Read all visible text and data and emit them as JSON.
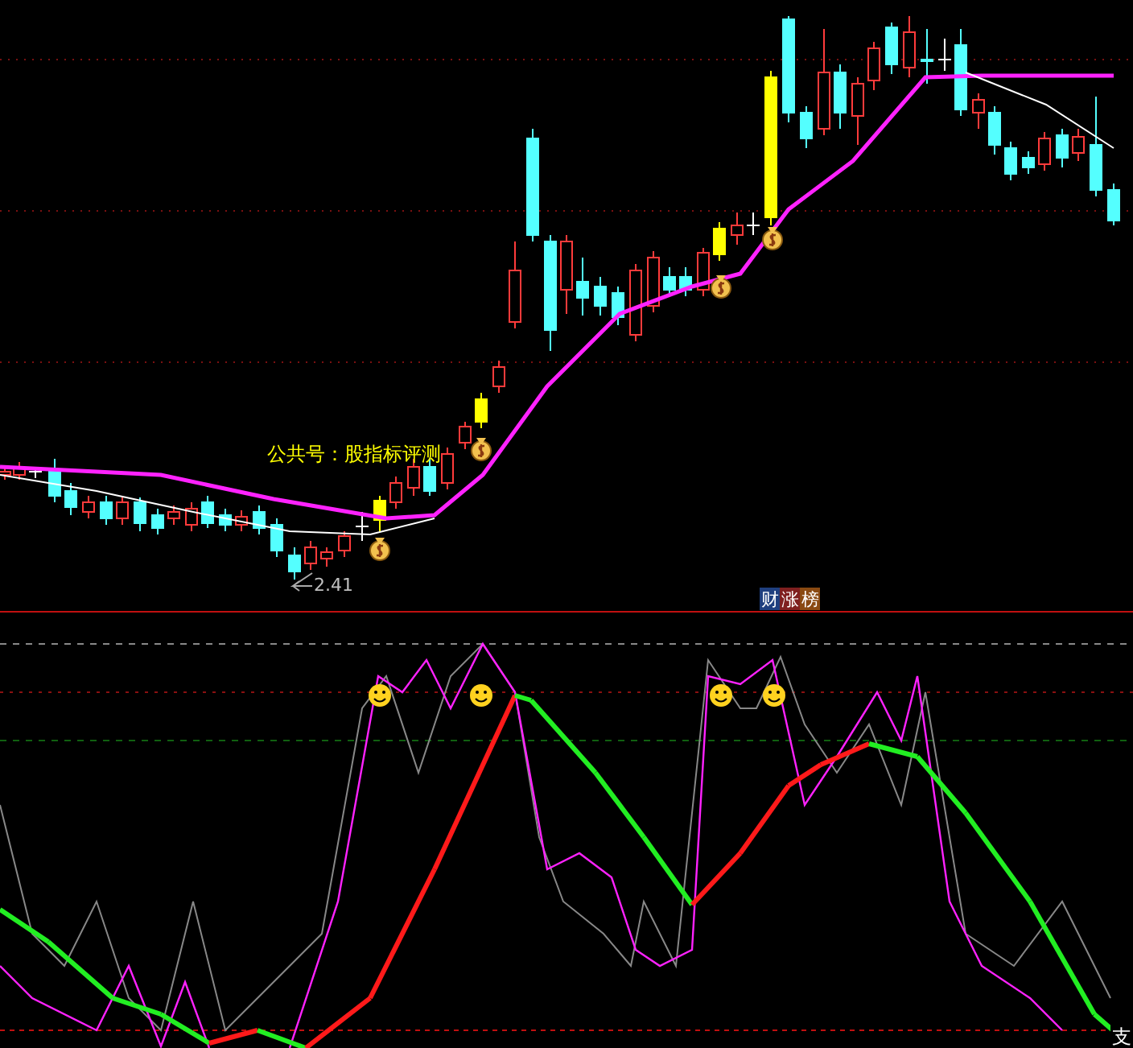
{
  "price_panel": {
    "caption": "公共号：股指标评测",
    "low_label": "2.41"
  },
  "badges": [
    {
      "text": "财",
      "color": "#1f3f7f"
    },
    {
      "text": "涨",
      "color": "#7f1f1f"
    },
    {
      "text": "榜",
      "color": "#8a4a12"
    }
  ],
  "oscillator": {
    "edge_label": "支"
  }
}
